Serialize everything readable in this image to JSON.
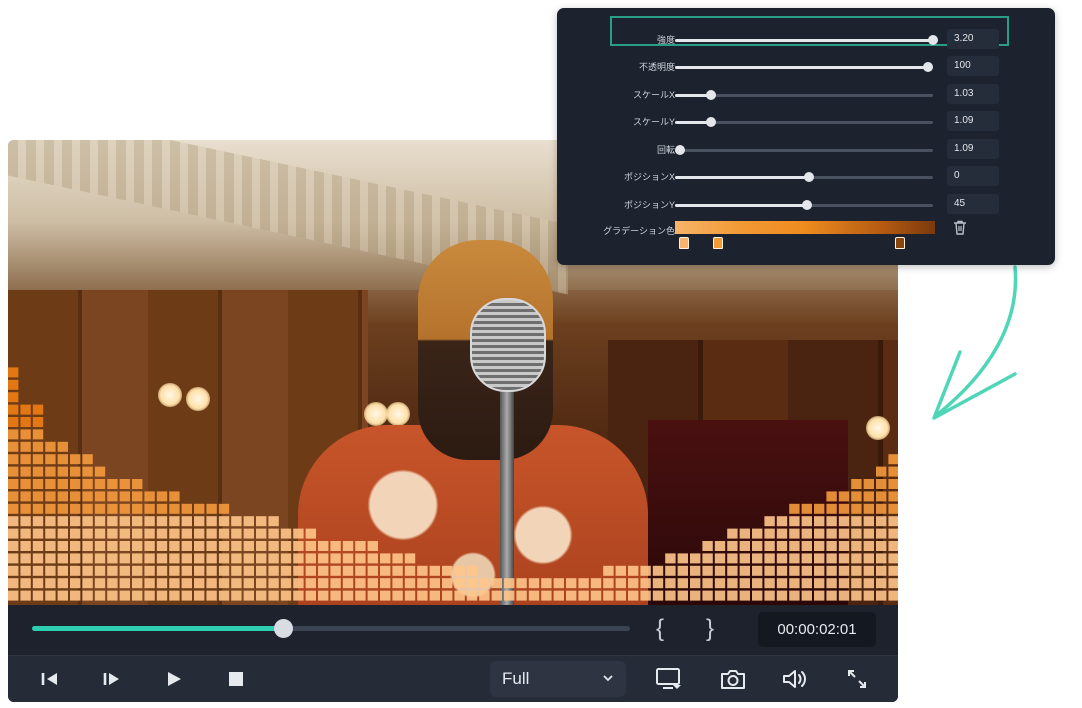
{
  "player": {
    "timecode": "00:00:02:01",
    "progress": 0.42,
    "mark_in": "{",
    "mark_out": "}",
    "quality": {
      "selected": "Full"
    },
    "controls": [
      {
        "name": "step-back-icon"
      },
      {
        "name": "step-forward-icon"
      },
      {
        "name": "play-icon"
      },
      {
        "name": "stop-icon"
      },
      {
        "name": "display-icon"
      },
      {
        "name": "camera-icon"
      },
      {
        "name": "volume-icon"
      },
      {
        "name": "fullscreen-icon"
      }
    ],
    "accent_color": "#2ecfb0"
  },
  "settings": {
    "rows": [
      {
        "label": "強度",
        "value": "3.20",
        "level": 1.0
      },
      {
        "label": "不透明度",
        "value": "100",
        "level": 0.98
      },
      {
        "label": "スケールX",
        "value": "1.03",
        "level": 0.14
      },
      {
        "label": "スケールY",
        "value": "1.09",
        "level": 0.14
      },
      {
        "label": "回転",
        "value": "1.09",
        "level": 0.02
      },
      {
        "label": "ポジションX",
        "value": "0",
        "level": 0.52
      },
      {
        "label": "ポジションY",
        "value": "45",
        "level": 0.51
      }
    ],
    "gradient": {
      "label": "グラデーション色",
      "stops": [
        {
          "pos": 0.03,
          "color": "#f7b46a"
        },
        {
          "pos": 0.16,
          "color": "#f29a34"
        },
        {
          "pos": 0.86,
          "color": "#8a450f"
        }
      ],
      "trash_icon": "trash-icon"
    },
    "highlight_color": "#2a9d86"
  },
  "arrow_color": "#4fd6b8"
}
